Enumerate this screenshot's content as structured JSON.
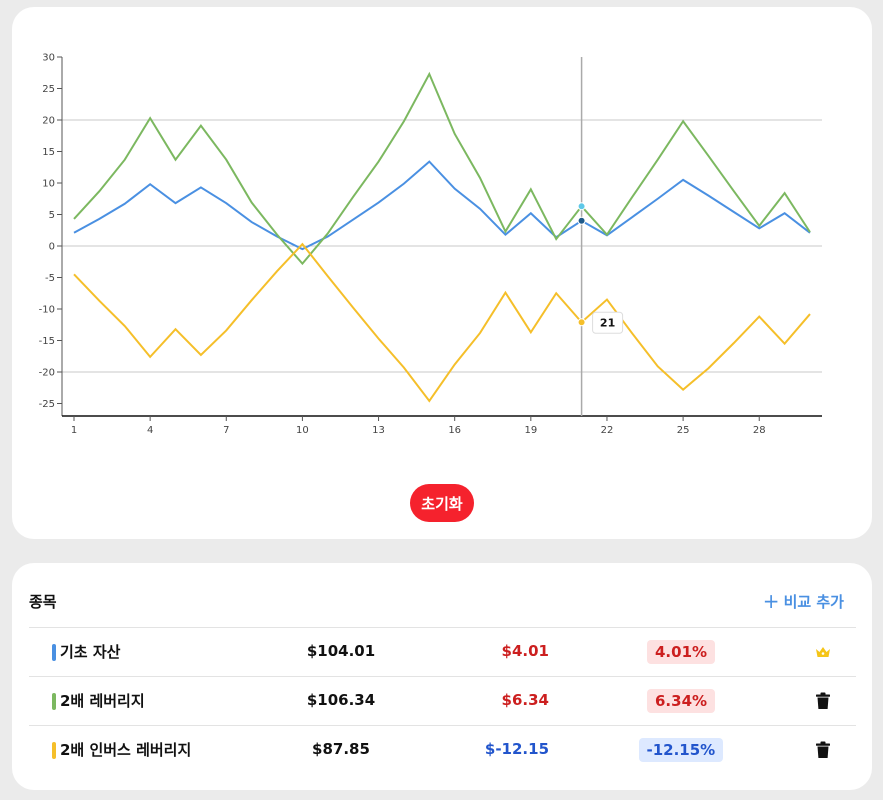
{
  "reset_label": "초기화",
  "list": {
    "title": "종목",
    "add_label": "비교 추가",
    "add_icon": "plus-icon",
    "rows": [
      {
        "name": "기초 자산",
        "price": "$104.01",
        "change": "$4.01",
        "pct": "4.01%",
        "color": "#4a90e2",
        "trend": "up",
        "action_icon": "crown-icon"
      },
      {
        "name": "2배 레버리지",
        "price": "$106.34",
        "change": "$6.34",
        "pct": "6.34%",
        "color": "#7cb860",
        "trend": "up",
        "action_icon": "trash-icon"
      },
      {
        "name": "2배 인버스 레버리지",
        "price": "$87.85",
        "change": "$-12.15",
        "pct": "-12.15%",
        "color": "#f5bf2a",
        "trend": "down",
        "action_icon": "trash-icon"
      }
    ]
  },
  "colors": {
    "up_text": "#cc1f1f",
    "up_bg": "#fde1e1",
    "down_text": "#2255cc",
    "down_bg": "#dde9ff",
    "reset_button": "#f5222d",
    "crown": "#f5c518"
  },
  "chart_data": {
    "type": "line",
    "x": [
      1,
      2,
      3,
      4,
      5,
      6,
      7,
      8,
      9,
      10,
      11,
      12,
      13,
      14,
      15,
      16,
      17,
      18,
      19,
      20,
      21,
      22,
      23,
      24,
      25,
      26,
      27,
      28,
      29,
      30
    ],
    "xticks": [
      1,
      4,
      7,
      10,
      13,
      16,
      19,
      22,
      25,
      28
    ],
    "yticks": [
      30,
      25,
      20,
      15,
      10,
      5,
      0,
      -5,
      -10,
      -15,
      -20,
      -25
    ],
    "ylim": [
      -27,
      30
    ],
    "grid_y": [
      20,
      0,
      -20
    ],
    "series": [
      {
        "color": "#4a90e2",
        "values": [
          2.1,
          4.3,
          6.7,
          9.8,
          6.8,
          9.3,
          6.8,
          3.8,
          1.5,
          -0.5,
          1.5,
          4.2,
          6.9,
          9.9,
          13.4,
          9.1,
          5.9,
          1.8,
          5.2,
          1.4,
          4.0,
          1.7,
          4.6,
          7.5,
          10.5,
          8.0,
          5.4,
          2.8,
          5.2,
          2.1
        ]
      },
      {
        "color": "#7cb860",
        "values": [
          4.3,
          8.7,
          13.7,
          20.3,
          13.7,
          19.1,
          13.7,
          6.9,
          1.8,
          -2.8,
          2.0,
          7.8,
          13.4,
          19.8,
          27.3,
          17.8,
          10.8,
          2.3,
          9.0,
          1.1,
          6.3,
          1.8,
          7.8,
          13.7,
          19.8,
          14.3,
          8.7,
          3.2,
          8.4,
          2.2
        ]
      },
      {
        "color": "#f5bf2a",
        "values": [
          -4.5,
          -8.7,
          -12.7,
          -17.6,
          -13.2,
          -17.3,
          -13.4,
          -8.6,
          -4.0,
          0.3,
          -4.8,
          -9.8,
          -14.7,
          -19.3,
          -24.6,
          -18.8,
          -13.8,
          -7.4,
          -13.7,
          -7.5,
          -12.1,
          -8.5,
          -13.9,
          -19.1,
          -22.8,
          -19.4,
          -15.4,
          -11.2,
          -15.5,
          -10.8
        ]
      }
    ],
    "hover": {
      "x": 21,
      "label": "21"
    }
  }
}
